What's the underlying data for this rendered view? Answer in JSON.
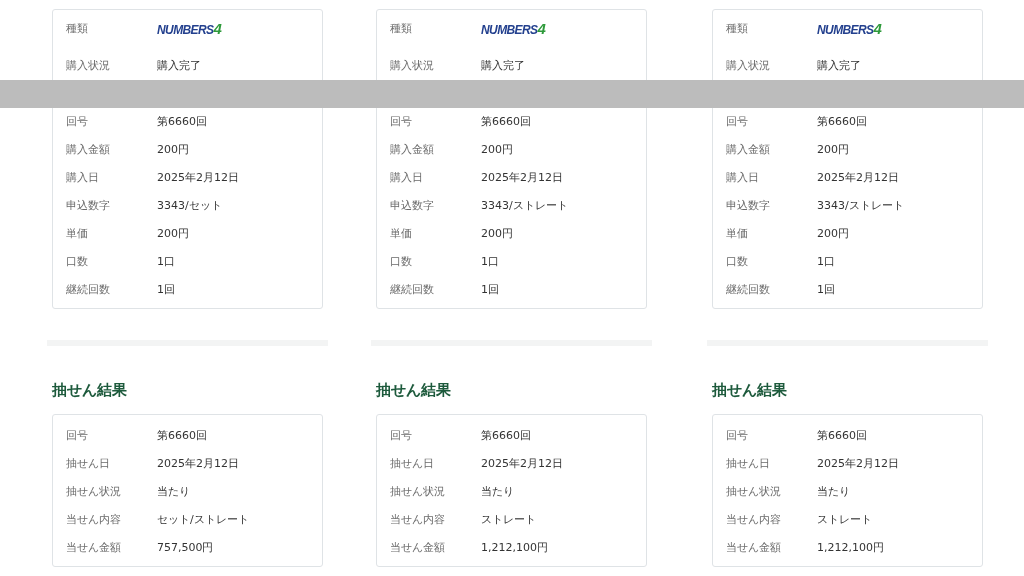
{
  "columns": [
    {
      "purchase": {
        "rows_above_band": [
          {
            "kind": "logo",
            "label": "種類",
            "logo_word": "NUMBERS",
            "logo_digit": "4"
          },
          {
            "kind": "text",
            "label": "購入状況",
            "value": "購入完了"
          }
        ],
        "rows_below_band": [
          {
            "label": "回号",
            "value": "第6660回"
          },
          {
            "label": "購入金額",
            "value": "200円"
          },
          {
            "label": "購入日",
            "value": "2025年2月12日"
          },
          {
            "label": "申込数字",
            "value": "3343/セット"
          },
          {
            "label": "単価",
            "value": "200円"
          },
          {
            "label": "口数",
            "value": "1口"
          },
          {
            "label": "継続回数",
            "value": "1回"
          }
        ]
      },
      "result": {
        "heading": "抽せん結果",
        "rows": [
          {
            "label": "回号",
            "value": "第6660回"
          },
          {
            "label": "抽せん日",
            "value": "2025年2月12日"
          },
          {
            "label": "抽せん状況",
            "value": "当たり"
          },
          {
            "label": "当せん内容",
            "value": "セット/ストレート"
          },
          {
            "label": "当せん金額",
            "value": "757,500円"
          }
        ]
      }
    },
    {
      "purchase": {
        "rows_above_band": [
          {
            "kind": "logo",
            "label": "種類",
            "logo_word": "NUMBERS",
            "logo_digit": "4"
          },
          {
            "kind": "text",
            "label": "購入状況",
            "value": "購入完了"
          }
        ],
        "rows_below_band": [
          {
            "label": "回号",
            "value": "第6660回"
          },
          {
            "label": "購入金額",
            "value": "200円"
          },
          {
            "label": "購入日",
            "value": "2025年2月12日"
          },
          {
            "label": "申込数字",
            "value": "3343/ストレート"
          },
          {
            "label": "単価",
            "value": "200円"
          },
          {
            "label": "口数",
            "value": "1口"
          },
          {
            "label": "継続回数",
            "value": "1回"
          }
        ]
      },
      "result": {
        "heading": "抽せん結果",
        "rows": [
          {
            "label": "回号",
            "value": "第6660回"
          },
          {
            "label": "抽せん日",
            "value": "2025年2月12日"
          },
          {
            "label": "抽せん状況",
            "value": "当たり"
          },
          {
            "label": "当せん内容",
            "value": "ストレート"
          },
          {
            "label": "当せん金額",
            "value": "1,212,100円"
          }
        ]
      }
    },
    {
      "purchase": {
        "rows_above_band": [
          {
            "kind": "logo",
            "label": "種類",
            "logo_word": "NUMBERS",
            "logo_digit": "4"
          },
          {
            "kind": "text",
            "label": "購入状況",
            "value": "購入完了"
          }
        ],
        "rows_below_band": [
          {
            "label": "回号",
            "value": "第6660回"
          },
          {
            "label": "購入金額",
            "value": "200円"
          },
          {
            "label": "購入日",
            "value": "2025年2月12日"
          },
          {
            "label": "申込数字",
            "value": "3343/ストレート"
          },
          {
            "label": "単価",
            "value": "200円"
          },
          {
            "label": "口数",
            "value": "1口"
          },
          {
            "label": "継続回数",
            "value": "1回"
          }
        ]
      },
      "result": {
        "heading": "抽せん結果",
        "rows": [
          {
            "label": "回号",
            "value": "第6660回"
          },
          {
            "label": "抽せん日",
            "value": "2025年2月12日"
          },
          {
            "label": "抽せん状況",
            "value": "当たり"
          },
          {
            "label": "当せん内容",
            "value": "ストレート"
          },
          {
            "label": "当せん金額",
            "value": "1,212,100円"
          }
        ]
      }
    }
  ]
}
